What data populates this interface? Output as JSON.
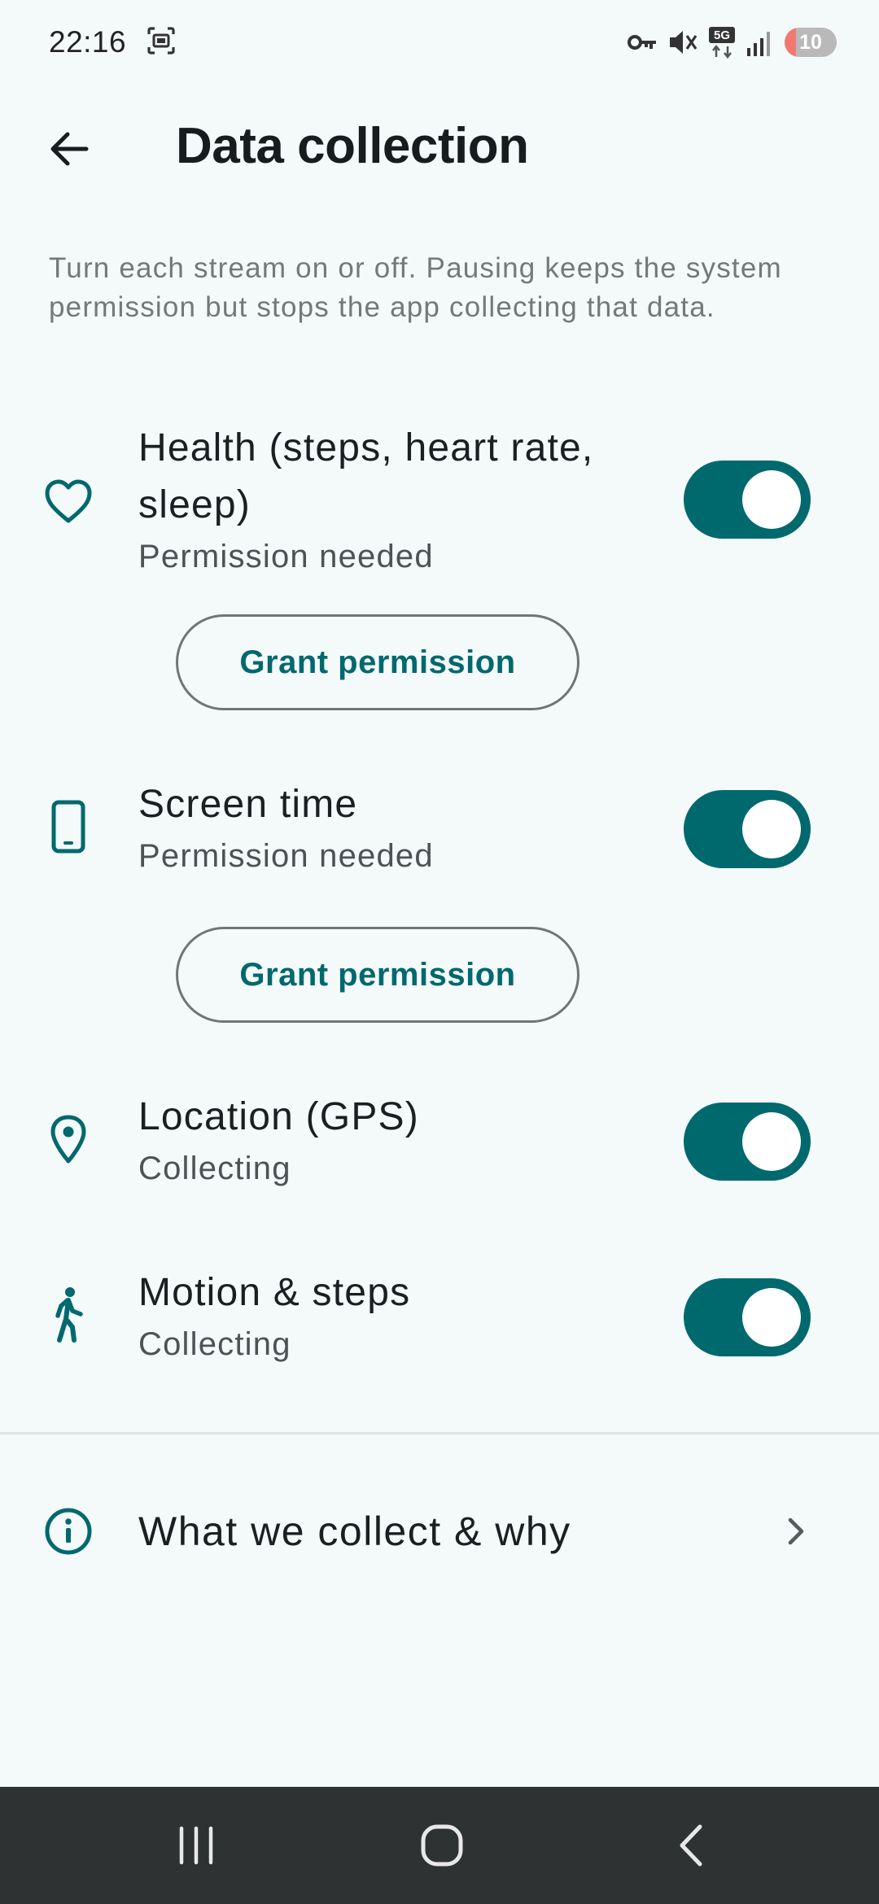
{
  "status_bar": {
    "time": "22:16",
    "battery_level": "10",
    "battery_fraction": 0.1,
    "icons": [
      "screenshot-icon",
      "vpn-key-icon",
      "mute-icon",
      "5g-data-icon",
      "signal-icon",
      "battery-icon"
    ]
  },
  "app_bar": {
    "back_icon": "arrow-left-icon",
    "title": "Data collection"
  },
  "description": "Turn each stream on or off. Pausing keeps the system permission but stops the app collecting that data.",
  "streams": [
    {
      "icon": "heart-icon",
      "title": "Health (steps, heart rate, sleep)",
      "status": "Permission needed",
      "enabled": true,
      "button": "Grant permission"
    },
    {
      "icon": "phone-icon",
      "title": "Screen time",
      "status": "Permission needed",
      "enabled": true,
      "button": "Grant permission"
    },
    {
      "icon": "location-pin-icon",
      "title": "Location (GPS)",
      "status": "Collecting",
      "enabled": true
    },
    {
      "icon": "walking-icon",
      "title": "Motion & steps",
      "status": "Collecting",
      "enabled": true
    }
  ],
  "info": {
    "icon": "info-icon",
    "label": "What we collect & why",
    "chevron": "chevron-right-icon"
  },
  "nav_bar": {
    "buttons": [
      "recent-apps-icon",
      "home-icon",
      "back-icon"
    ]
  },
  "colors": {
    "accent": "#00696e",
    "background": "#f4f9fa",
    "nav_bar": "#2f3233",
    "battery_low": "#f07a72"
  }
}
